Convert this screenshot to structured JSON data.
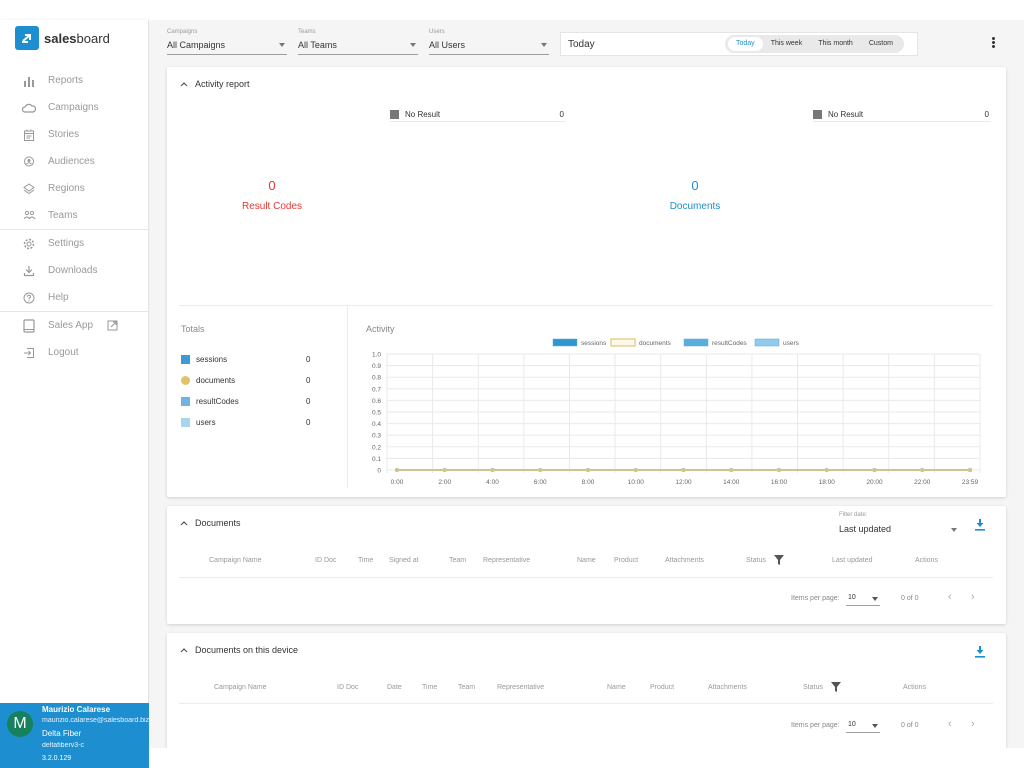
{
  "sidebar": {
    "logo_bold": "sales",
    "logo_rest": "board",
    "items": [
      {
        "label": "Reports",
        "icon": "bar-chart-icon"
      },
      {
        "label": "Campaigns",
        "icon": "cloud-icon"
      },
      {
        "label": "Stories",
        "icon": "calendar-icon"
      },
      {
        "label": "Audiences",
        "icon": "person-pin-icon"
      },
      {
        "label": "Regions",
        "icon": "layers-icon"
      },
      {
        "label": "Teams",
        "icon": "group-icon"
      },
      {
        "label": "Settings",
        "icon": "gear-icon"
      },
      {
        "label": "Downloads",
        "icon": "download-icon"
      },
      {
        "label": "Help",
        "icon": "help-icon"
      },
      {
        "label": "Sales App",
        "icon": "tablet-icon"
      },
      {
        "label": "Logout",
        "icon": "logout-icon"
      }
    ],
    "user": {
      "initial": "M",
      "name": "Maurizio Calarese",
      "email": "maurizio.calarese@salesboard.biz",
      "org": "Delta Fiber",
      "env": "deltafiberv3-c",
      "version": "3.2.0.129"
    }
  },
  "toolbar": {
    "filters": [
      {
        "label": "Campaigns",
        "value": "All Campaigns"
      },
      {
        "label": "Teams",
        "value": "All Teams"
      },
      {
        "label": "Users",
        "value": "All Users"
      }
    ],
    "date_current": "Today",
    "date_options": [
      "Today",
      "This week",
      "This month",
      "Custom"
    ],
    "date_active": "Today"
  },
  "activity_report": {
    "title": "Activity report",
    "result_codes": {
      "count": "0",
      "label": "Result Codes",
      "legend": [
        {
          "name": "No Result",
          "count": "0"
        }
      ]
    },
    "documents": {
      "count": "0",
      "label": "Documents",
      "legend": [
        {
          "name": "No Result",
          "count": "0"
        }
      ]
    },
    "totals_title": "Totals",
    "totals": [
      {
        "name": "sessions",
        "value": "0",
        "color": "#3a9bd5"
      },
      {
        "name": "documents",
        "value": "0",
        "color": "#e0c26a"
      },
      {
        "name": "resultCodes",
        "value": "0",
        "color": "#6fb3df"
      },
      {
        "name": "users",
        "value": "0",
        "color": "#a8d4ee"
      }
    ],
    "activity_title": "Activity"
  },
  "chart_data": {
    "type": "line",
    "title": "Activity",
    "x": [
      "0:00",
      "2:00",
      "4:00",
      "6:00",
      "8:00",
      "10:00",
      "12:00",
      "14:00",
      "16:00",
      "18:00",
      "20:00",
      "22:00",
      "23:59"
    ],
    "series": [
      {
        "name": "sessions",
        "values": [
          0,
          0,
          0,
          0,
          0,
          0,
          0,
          0,
          0,
          0,
          0,
          0,
          0
        ],
        "color": "#2f97d0"
      },
      {
        "name": "documents",
        "values": [
          0,
          0,
          0,
          0,
          0,
          0,
          0,
          0,
          0,
          0,
          0,
          0,
          0
        ],
        "color": "#e3c47a"
      },
      {
        "name": "resultCodes",
        "values": [
          0,
          0,
          0,
          0,
          0,
          0,
          0,
          0,
          0,
          0,
          0,
          0,
          0
        ],
        "color": "#5aaedc"
      },
      {
        "name": "users",
        "values": [
          0,
          0,
          0,
          0,
          0,
          0,
          0,
          0,
          0,
          0,
          0,
          0,
          0
        ],
        "color": "#8fcbeb"
      }
    ],
    "yticks": [
      "0",
      "0.1",
      "0.2",
      "0.3",
      "0.4",
      "0.5",
      "0.6",
      "0.7",
      "0.8",
      "0.9",
      "1.0"
    ],
    "ylim": [
      0,
      1
    ],
    "grid": true,
    "legend": "top-right"
  },
  "documents": {
    "title": "Documents",
    "filter_label": "Filter date:",
    "filter_value": "Last updated",
    "columns": [
      "Campaign Name",
      "ID Doc",
      "Time",
      "Signed at",
      "Team",
      "Representative",
      "Name",
      "Product",
      "Attachments",
      "Status",
      "Last updated",
      "Actions"
    ],
    "items_per_page_label": "Items per page:",
    "items_per_page": "10",
    "range": "0 of 0"
  },
  "device_documents": {
    "title": "Documents on this device",
    "columns": [
      "Campaign Name",
      "ID Doc",
      "Date",
      "Time",
      "Team",
      "Representative",
      "Name",
      "Product",
      "Attachments",
      "Status",
      "Actions"
    ],
    "items_per_page_label": "Items per page:",
    "items_per_page": "10",
    "range": "0 of 0"
  }
}
